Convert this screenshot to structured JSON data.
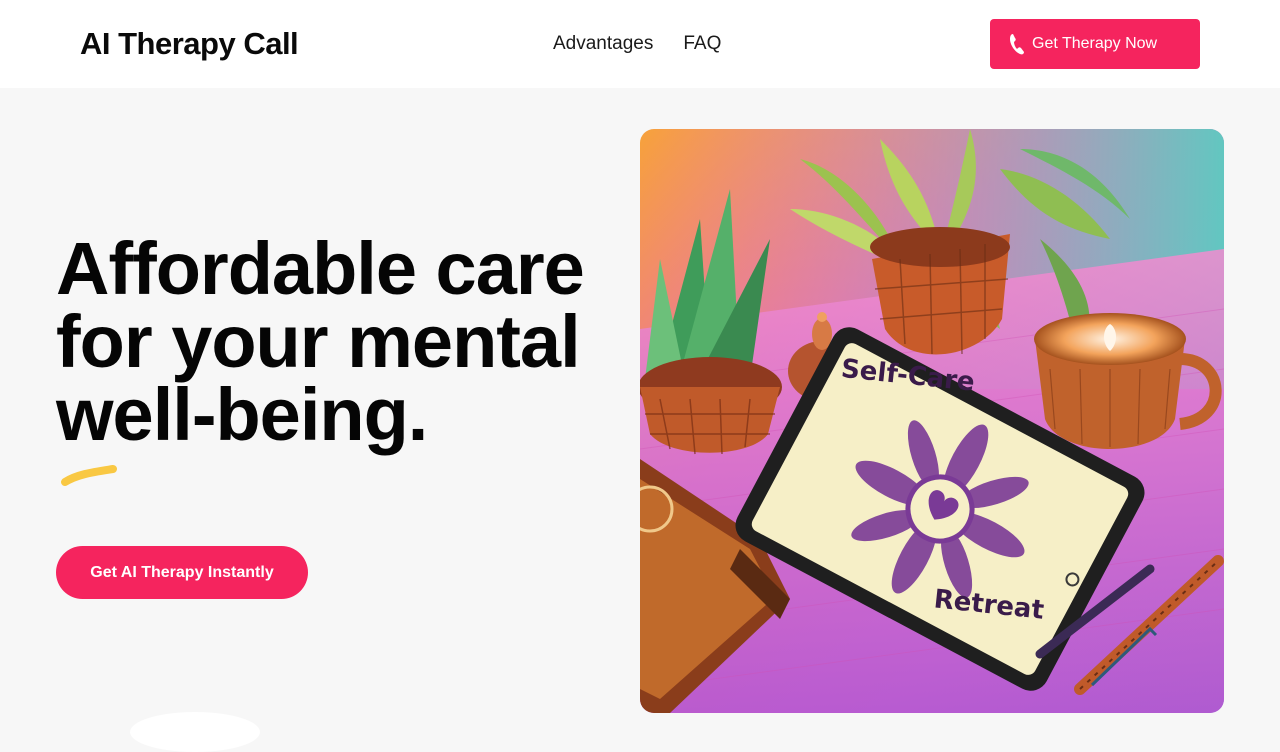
{
  "header": {
    "brand": "AI Therapy Call",
    "nav": [
      "Advantages",
      "FAQ"
    ],
    "cta_label": "Get Therapy Now"
  },
  "hero": {
    "headline_lines": [
      "Affordable care",
      "for your mental",
      "well-being."
    ],
    "button_label": "Get AI Therapy Instantly",
    "image": {
      "tablet_text_top": "Self-Care",
      "tablet_text_bottom": "Retreat"
    }
  },
  "colors": {
    "accent": "#f5245e",
    "squiggle": "#f9c843"
  },
  "icons": {
    "cta_top": "phone-icon"
  }
}
